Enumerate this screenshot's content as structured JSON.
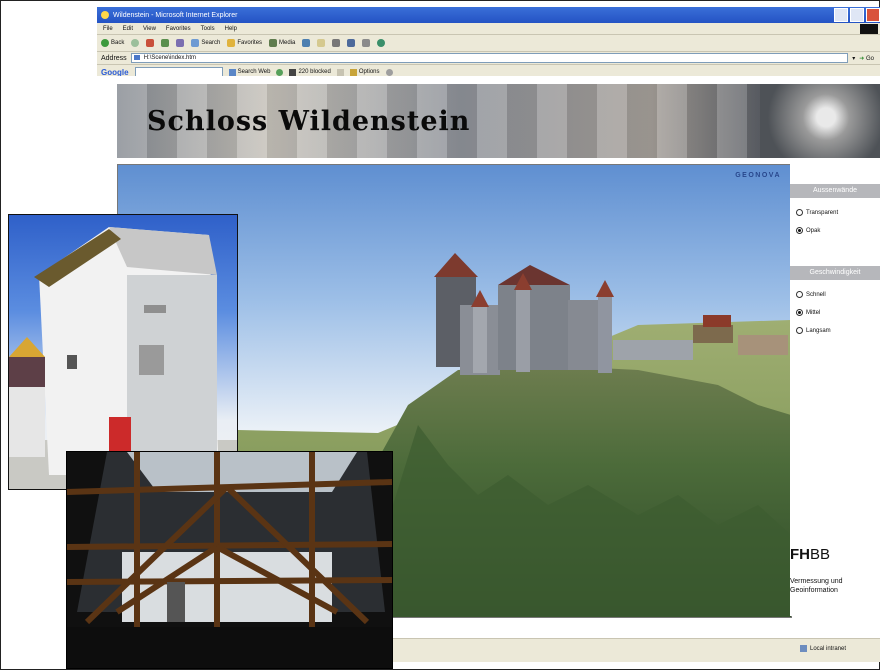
{
  "browser": {
    "window_title": "Wildenstein - Microsoft Internet Explorer",
    "menu": [
      "File",
      "Edit",
      "View",
      "Favorites",
      "Tools",
      "Help"
    ],
    "toolbar": {
      "back": "Back",
      "search": "Search",
      "favorites": "Favorites",
      "media": "Media"
    },
    "address_label": "Address",
    "address_value": "H:\\Scene\\index.htm",
    "go_label": "Go",
    "google": {
      "logo": "Google",
      "search_web": "Search Web",
      "blocked": "220 blocked",
      "options": "Options"
    },
    "status_zone": "Local intranet"
  },
  "page": {
    "banner_title": "Schloss Wildenstein",
    "view_brand": "GEONOVA",
    "panel": {
      "section1": "Aussenwände",
      "section1_options": [
        {
          "label": "Transparent",
          "selected": false
        },
        {
          "label": "Opak",
          "selected": true
        }
      ],
      "section2": "Geschwindigkeit",
      "section2_options": [
        {
          "label": "Schnell",
          "selected": false
        },
        {
          "label": "Mittel",
          "selected": true
        },
        {
          "label": "Langsam",
          "selected": false
        }
      ]
    },
    "institution": {
      "fh": "FH",
      "bb": "BB",
      "line1": "Vermessung und",
      "line2": "Geoinformation"
    }
  }
}
